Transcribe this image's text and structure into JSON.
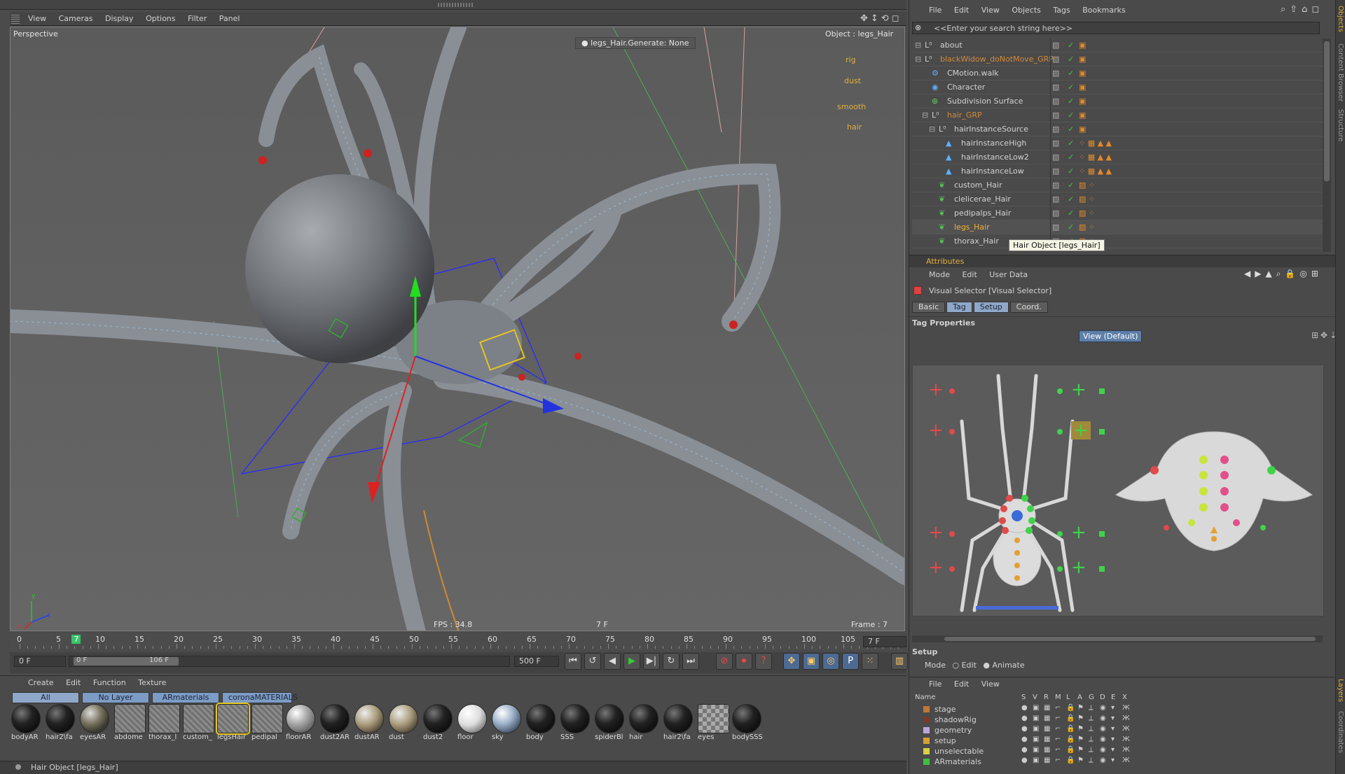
{
  "viewport": {
    "menu": [
      "View",
      "Cameras",
      "Display",
      "Options",
      "Filter",
      "Panel"
    ],
    "camera_label": "Perspective",
    "hud_generate": "legs_Hair.Generate: None",
    "object_label": "Object : legs_Hair",
    "fps": "FPS : 34.8",
    "frame_center": "7 F",
    "frame_right": "Frame : 7",
    "object_tags": [
      "rig",
      "dust",
      "smooth",
      "hair"
    ],
    "axis_x": "x",
    "axis_y": "y",
    "axis_z": "z"
  },
  "timeline": {
    "ticks": [
      "0",
      "5",
      "7",
      "10",
      "15",
      "20",
      "25",
      "30",
      "35",
      "40",
      "45",
      "50",
      "55",
      "60",
      "65",
      "70",
      "75",
      "80",
      "85",
      "90",
      "95",
      "100",
      "105"
    ],
    "current_frame": "7 F",
    "start_field": "0 F",
    "range_start": "0 F",
    "range_end": "106 F",
    "end_field": "500 F",
    "transport": [
      "⏮",
      "↺",
      "◀",
      "▶",
      "▶|",
      "↻",
      "⏭"
    ]
  },
  "materials": {
    "menu": [
      "Create",
      "Edit",
      "Function",
      "Texture"
    ],
    "layer_tabs": [
      "All",
      "No Layer",
      "ARmaterials",
      "coronaMATERIALS"
    ],
    "items": [
      {
        "label": "bodyAR",
        "kind": "dark"
      },
      {
        "label": "hair2\\fa",
        "kind": "dark"
      },
      {
        "label": "eyesAR",
        "kind": "glass"
      },
      {
        "label": "abdome",
        "kind": "hatch"
      },
      {
        "label": "thorax_l",
        "kind": "hatch"
      },
      {
        "label": "custom_",
        "kind": "hatch"
      },
      {
        "label": "legsHair",
        "kind": "hatch-sel"
      },
      {
        "label": "pedipal",
        "kind": "hatch"
      },
      {
        "label": "floorAR",
        "kind": "grey"
      },
      {
        "label": "dust2AR",
        "kind": "dark"
      },
      {
        "label": "dustAR",
        "kind": "tan"
      },
      {
        "label": "dust",
        "kind": "tan"
      },
      {
        "label": "dust2",
        "kind": "dark"
      },
      {
        "label": "floor",
        "kind": "white"
      },
      {
        "label": "sky",
        "kind": "sky"
      },
      {
        "label": "body",
        "kind": "dark"
      },
      {
        "label": "SSS",
        "kind": "dark"
      },
      {
        "label": "spiderBl",
        "kind": "dark"
      },
      {
        "label": "hair",
        "kind": "dark"
      },
      {
        "label": "hair2\\fa",
        "kind": "dark"
      },
      {
        "label": "eyes",
        "kind": "check"
      },
      {
        "label": "bodySSS",
        "kind": "dark"
      }
    ]
  },
  "status_bar": "Hair Object [legs_Hair]",
  "objects": {
    "menu": [
      "File",
      "Edit",
      "View",
      "Objects",
      "Tags",
      "Bookmarks"
    ],
    "search_placeholder": "<<Enter your search string here>>",
    "rows": [
      {
        "name": "about",
        "color": "#d2d2d2",
        "indent": 0,
        "icon": "null"
      },
      {
        "name": "blackWidow_doNotMove_GRP",
        "color": "#d28a3a",
        "indent": 0,
        "icon": "null"
      },
      {
        "name": "CMotion.walk",
        "color": "#d2d2d2",
        "indent": 1,
        "icon": "cmotion"
      },
      {
        "name": "Character",
        "color": "#d2d2d2",
        "indent": 1,
        "icon": "character"
      },
      {
        "name": "Subdivision Surface",
        "color": "#d2d2d2",
        "indent": 1,
        "icon": "subdiv"
      },
      {
        "name": "hair_GRP",
        "color": "#d28a3a",
        "indent": 1,
        "icon": "null"
      },
      {
        "name": "hairInstanceSource",
        "color": "#d2d2d2",
        "indent": 2,
        "icon": "null"
      },
      {
        "name": "hairInstanceHigh",
        "color": "#d2d2d2",
        "indent": 3,
        "icon": "poly"
      },
      {
        "name": "hairInstanceLow2",
        "color": "#d2d2d2",
        "indent": 3,
        "icon": "poly"
      },
      {
        "name": "hairInstanceLow",
        "color": "#d2d2d2",
        "indent": 3,
        "icon": "poly"
      },
      {
        "name": "custom_Hair",
        "color": "#d2d2d2",
        "indent": 2,
        "icon": "hair"
      },
      {
        "name": "clelicerae_Hair",
        "color": "#d2d2d2",
        "indent": 2,
        "icon": "hair"
      },
      {
        "name": "pedipalps_Hair",
        "color": "#d2d2d2",
        "indent": 2,
        "icon": "hair"
      },
      {
        "name": "legs_Hair",
        "color": "#f0b040",
        "indent": 2,
        "icon": "hair"
      },
      {
        "name": "thorax_Hair",
        "color": "#d2d2d2",
        "indent": 2,
        "icon": "hair"
      }
    ],
    "tooltip": "Hair Object [legs_Hair]"
  },
  "attributes": {
    "header": "Attributes",
    "menu": [
      "Mode",
      "Edit",
      "User Data"
    ],
    "title": "Visual Selector [Visual Selector]",
    "tabs": [
      "Basic",
      "Tag",
      "Setup",
      "Coord."
    ],
    "active_tabs": [
      "Tag",
      "Setup"
    ],
    "section": "Tag Properties",
    "view_button": "View (Default)",
    "setup_label": "Setup",
    "mode_label": "Mode",
    "mode_options": [
      "Edit",
      "Animate"
    ],
    "mode_selected": "Animate"
  },
  "layers": {
    "menu": [
      "File",
      "Edit",
      "View"
    ],
    "columns": [
      "Name",
      "S",
      "V",
      "R",
      "M",
      "L",
      "A",
      "G",
      "D",
      "E",
      "X"
    ],
    "rows": [
      {
        "name": "stage",
        "color": "#c07838"
      },
      {
        "name": "shadowRig",
        "color": "#7a3a2a"
      },
      {
        "name": "geometry",
        "color": "#b8a8d8"
      },
      {
        "name": "setup",
        "color": "#d8a030"
      },
      {
        "name": "unselectable",
        "color": "#d8d040"
      },
      {
        "name": "ARmaterials",
        "color": "#40c040"
      }
    ]
  },
  "side_tabs": [
    "Objects",
    "Content Browser",
    "Structure",
    "Layers",
    "Coordinates"
  ]
}
